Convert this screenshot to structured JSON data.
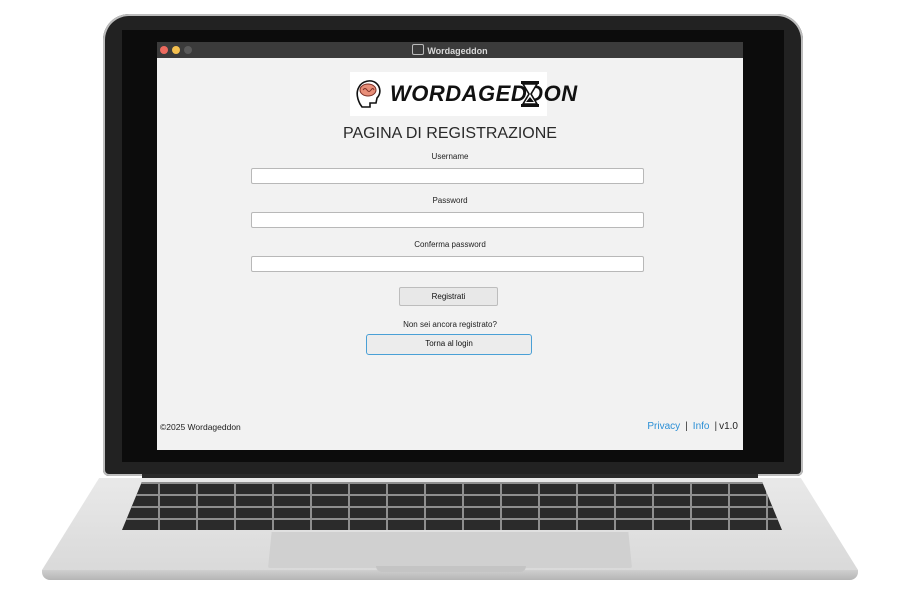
{
  "window": {
    "title": "Wordageddon"
  },
  "logo": {
    "text": "WORDAGEDDON"
  },
  "page": {
    "title": "PAGINA DI REGISTRAZIONE"
  },
  "form": {
    "username_label": "Username",
    "username_value": "",
    "password_label": "Password",
    "password_value": "",
    "confirm_label": "Conferma password",
    "confirm_value": "",
    "register_button": "Registrati",
    "hint": "Non sei ancora registrato?",
    "login_button": "Torna al login"
  },
  "footer": {
    "copyright": "©2025 Wordageddon",
    "privacy": "Privacy",
    "separator": "|",
    "info": "Info",
    "version": "v1.0"
  },
  "colors": {
    "link": "#2b8fd6",
    "focus_border": "#4aa0d6",
    "titlebar": "#3b3b3b"
  },
  "icons": [
    "brain-head-icon",
    "hourglass-icon",
    "app-icon"
  ]
}
